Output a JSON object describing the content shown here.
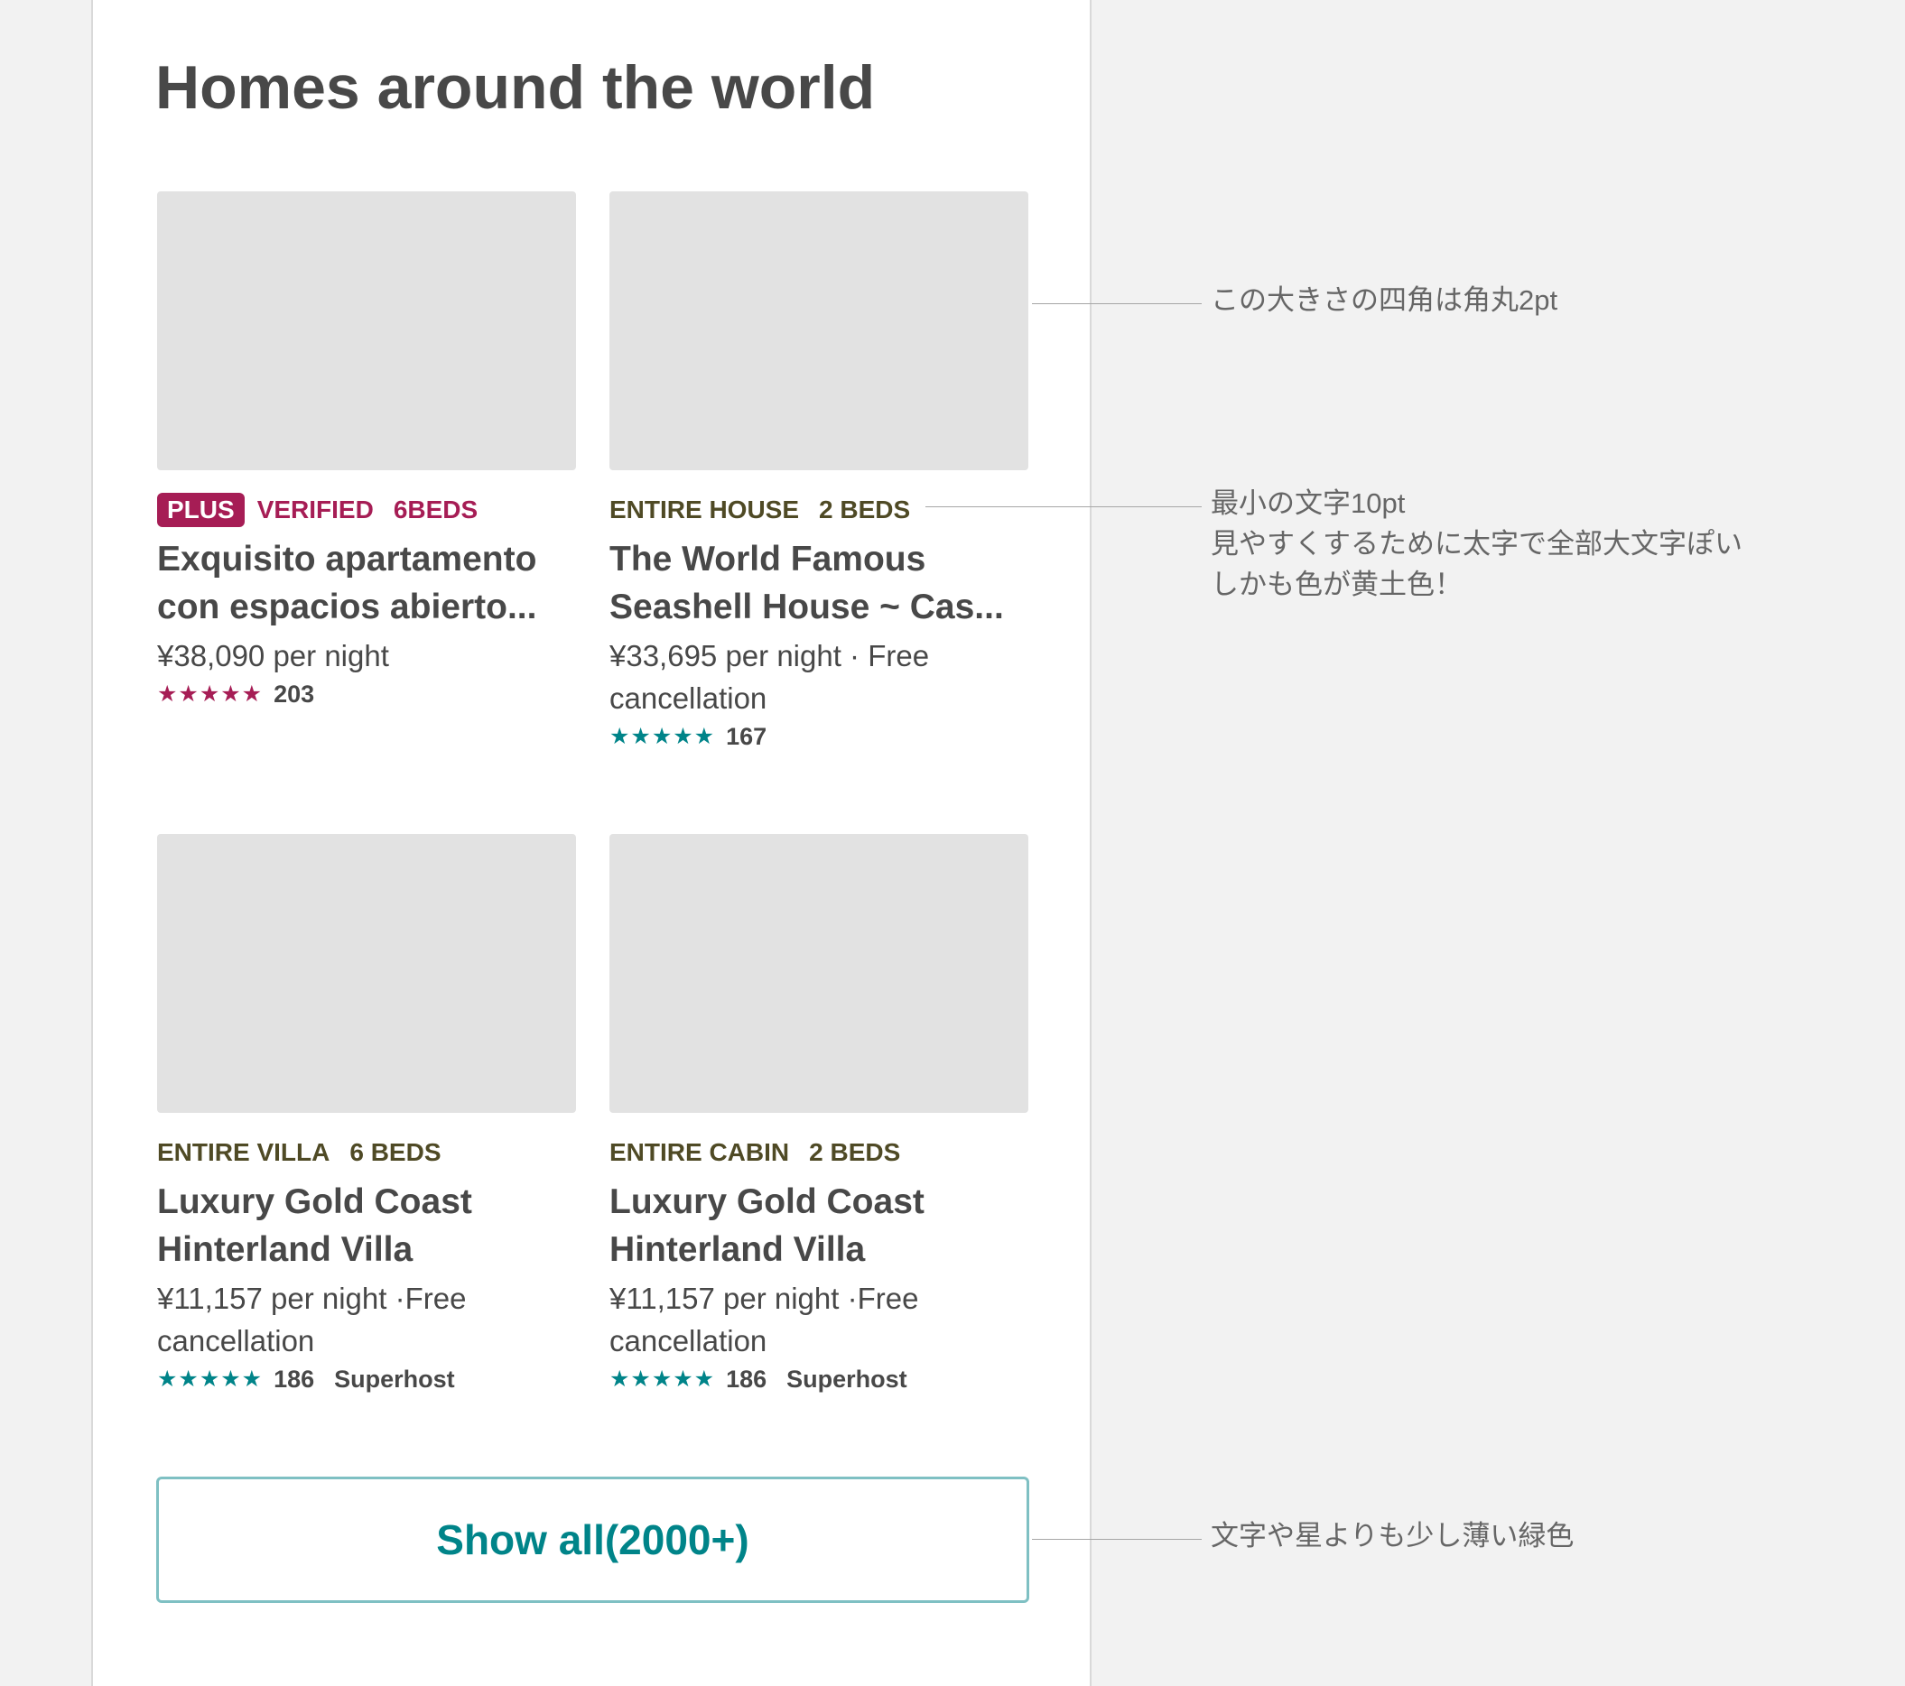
{
  "page": {
    "title": "Homes around the world"
  },
  "colors": {
    "background": "#f2f2f2",
    "panel": "#ffffff",
    "photo_placeholder": "#e2e2e2",
    "plus_pink": "#a61d55",
    "ochre": "#4f4a25",
    "teal": "#008489",
    "button_border": "#7fc0c3",
    "text": "#484848",
    "annotation_text": "#666666"
  },
  "listings": [
    {
      "badge": "PLUS",
      "tags": [
        "VERIFIED",
        "6BEDS"
      ],
      "tag_color": "plus_pink",
      "title_lines": [
        "Exquisito apartamento",
        "con espacios abierto..."
      ],
      "price_lines": [
        "¥38,090 per night"
      ],
      "stars": "★★★★★",
      "star_color": "plus_pink",
      "review_count": "203",
      "host_badge": ""
    },
    {
      "badge": "",
      "tags": [
        "ENTIRE HOUSE",
        "2 BEDS"
      ],
      "tag_color": "ochre",
      "title_lines": [
        "The World Famous",
        "Seashell House ~ Cas..."
      ],
      "price_lines": [
        "¥33,695 per night · Free",
        "cancellation"
      ],
      "stars": "★★★★★",
      "star_color": "teal",
      "review_count": "167",
      "host_badge": ""
    },
    {
      "badge": "",
      "tags": [
        "ENTIRE VILLA",
        "6 BEDS"
      ],
      "tag_color": "ochre",
      "title_lines": [
        "Luxury Gold Coast",
        "Hinterland Villa"
      ],
      "price_lines": [
        "¥11,157 per night ·Free",
        "cancellation"
      ],
      "stars": "★★★★★",
      "star_color": "teal",
      "review_count": "186",
      "host_badge": "Superhost"
    },
    {
      "badge": "",
      "tags": [
        "ENTIRE CABIN",
        "2 BEDS"
      ],
      "tag_color": "ochre",
      "title_lines": [
        "Luxury Gold Coast",
        "Hinterland Villa"
      ],
      "price_lines": [
        "¥11,157 per night ·Free",
        "cancellation"
      ],
      "stars": "★★★★★",
      "star_color": "teal",
      "review_count": "186",
      "host_badge": "Superhost"
    }
  ],
  "show_all": {
    "label": "Show all(2000+)"
  },
  "annotations": [
    {
      "lines": [
        "この大きさの四角は角丸2pt"
      ]
    },
    {
      "lines": [
        "最小の文字10pt",
        "見やすくするために太字で全部大文字ぽい",
        "しかも色が黄土色！"
      ]
    },
    {
      "lines": [
        "文字や星よりも少し薄い緑色"
      ]
    }
  ]
}
